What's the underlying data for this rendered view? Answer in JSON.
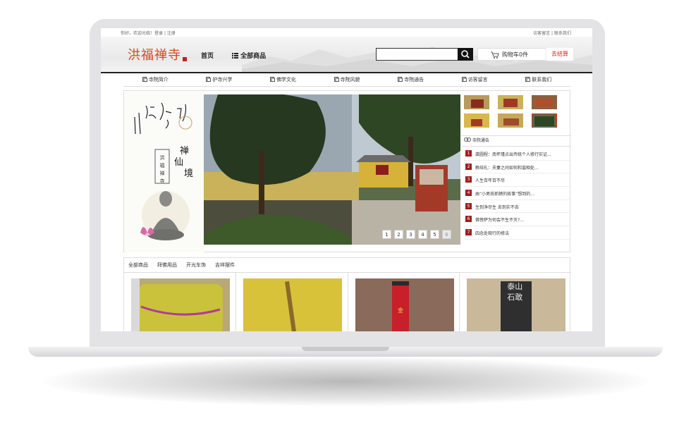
{
  "topbar": {
    "left_greeting": "你好，欢迎光临！",
    "login": "登录",
    "sep": " | ",
    "register": "注册",
    "right_a": "访客留言",
    "right_b": "联系我们"
  },
  "header": {
    "logo_text": "洪福禅寺",
    "home_label": "首页",
    "all_products_label": "全部商品",
    "cart_label": "购物车0件",
    "checkout_label": "去结算",
    "search": {
      "value": "",
      "placeholder": ""
    }
  },
  "menu": {
    "items": [
      {
        "label": "寺院简介"
      },
      {
        "label": "护寺兴学"
      },
      {
        "label": "佛学文化"
      },
      {
        "label": "寺院风貌"
      },
      {
        "label": "寺院通告"
      },
      {
        "label": "访客留言"
      },
      {
        "label": "联系我们"
      }
    ]
  },
  "left_art": {
    "calligraphy_big": "禅仙境",
    "seal_text": "洪福禅寺"
  },
  "slider": {
    "pages": [
      "1",
      "2",
      "3",
      "4",
      "5",
      "6"
    ],
    "active_page": "6"
  },
  "notice": {
    "title": "寺院通告",
    "items": [
      {
        "num": "1",
        "text": "龚圆程：南怀瑾点出传统个人修行实证..."
      },
      {
        "num": "2",
        "text": "赖培礼：夫妻之间如何和谐相处..."
      },
      {
        "num": "3",
        "text": "人生百年百不尽"
      },
      {
        "num": "4",
        "text": "由“小男孩抓螃的故事”想到的..."
      },
      {
        "num": "5",
        "text": "生到净尽生 去到实不去"
      },
      {
        "num": "6",
        "text": "佛菩萨为何会不生不灭?..."
      },
      {
        "num": "7",
        "text": "四念处观行的修法"
      }
    ]
  },
  "products": {
    "tabs": [
      "全部商品",
      "拜佛用品",
      "开光车饰",
      "吉祥摆件"
    ],
    "cards": [
      {
        "name": "yellow-cushion"
      },
      {
        "name": "yellow-cloth"
      },
      {
        "name": "red-tube"
      },
      {
        "name": "taishan-stone",
        "img_text": "泰山石敢"
      }
    ]
  },
  "colors": {
    "logo": "#d14a1b",
    "number_badge": "#a01e1e",
    "checkout": "#dd2222"
  }
}
